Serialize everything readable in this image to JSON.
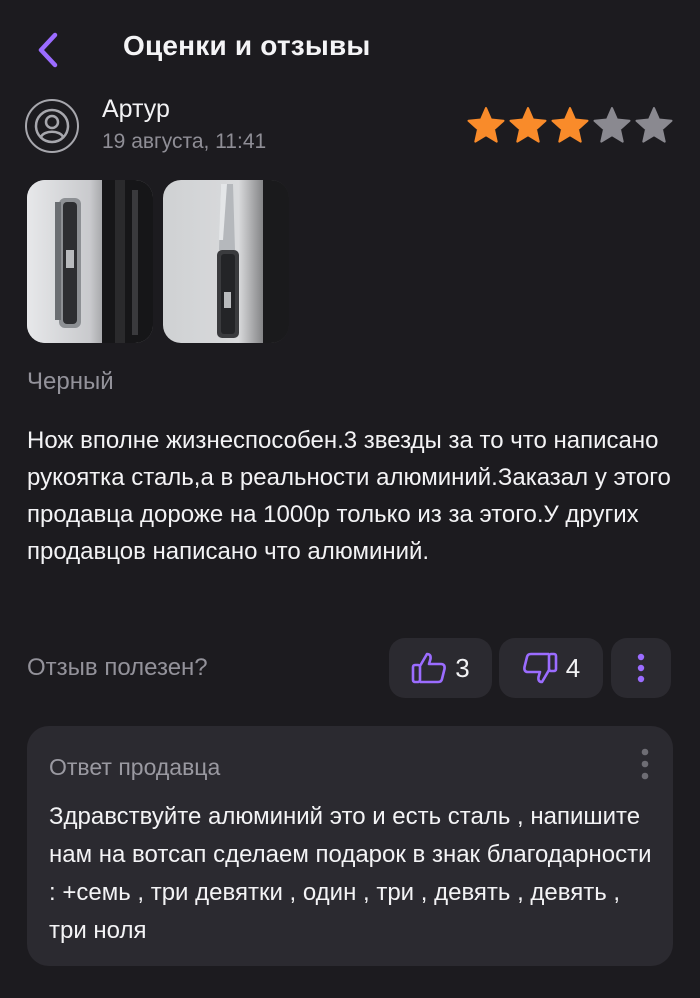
{
  "header": {
    "title": "Оценки и отзывы",
    "back_icon": "chevron-left-icon"
  },
  "colors": {
    "accent": "#9b6cff",
    "star_active": "#f98b2a",
    "star_inactive": "#8a8990",
    "background": "#1c1b1f",
    "card": "#2b2a30"
  },
  "review": {
    "author": "Артур",
    "date": "19 августа, 11:41",
    "rating": 3,
    "max_rating": 5,
    "photos": [
      "knife-closed-photo",
      "knife-open-photo"
    ],
    "variant": "Черный",
    "text": "Нож вполне жизнеспособен.3 звезды за то что написано рукоятка сталь,а в реальности алюминий.Заказал у этого продавца дороже на 1000р только из за этого.У других продавцов написано что алюминий."
  },
  "helpful": {
    "label": "Отзыв полезен?",
    "likes": "3",
    "dislikes": "4"
  },
  "seller_reply": {
    "title": "Ответ продавца",
    "text": "Здравствуйте алюминий это и есть сталь , напишите нам на вотсап сделаем подарок в знак благодарности : +семь , три девятки , один , три , девять , девять , три ноля"
  }
}
